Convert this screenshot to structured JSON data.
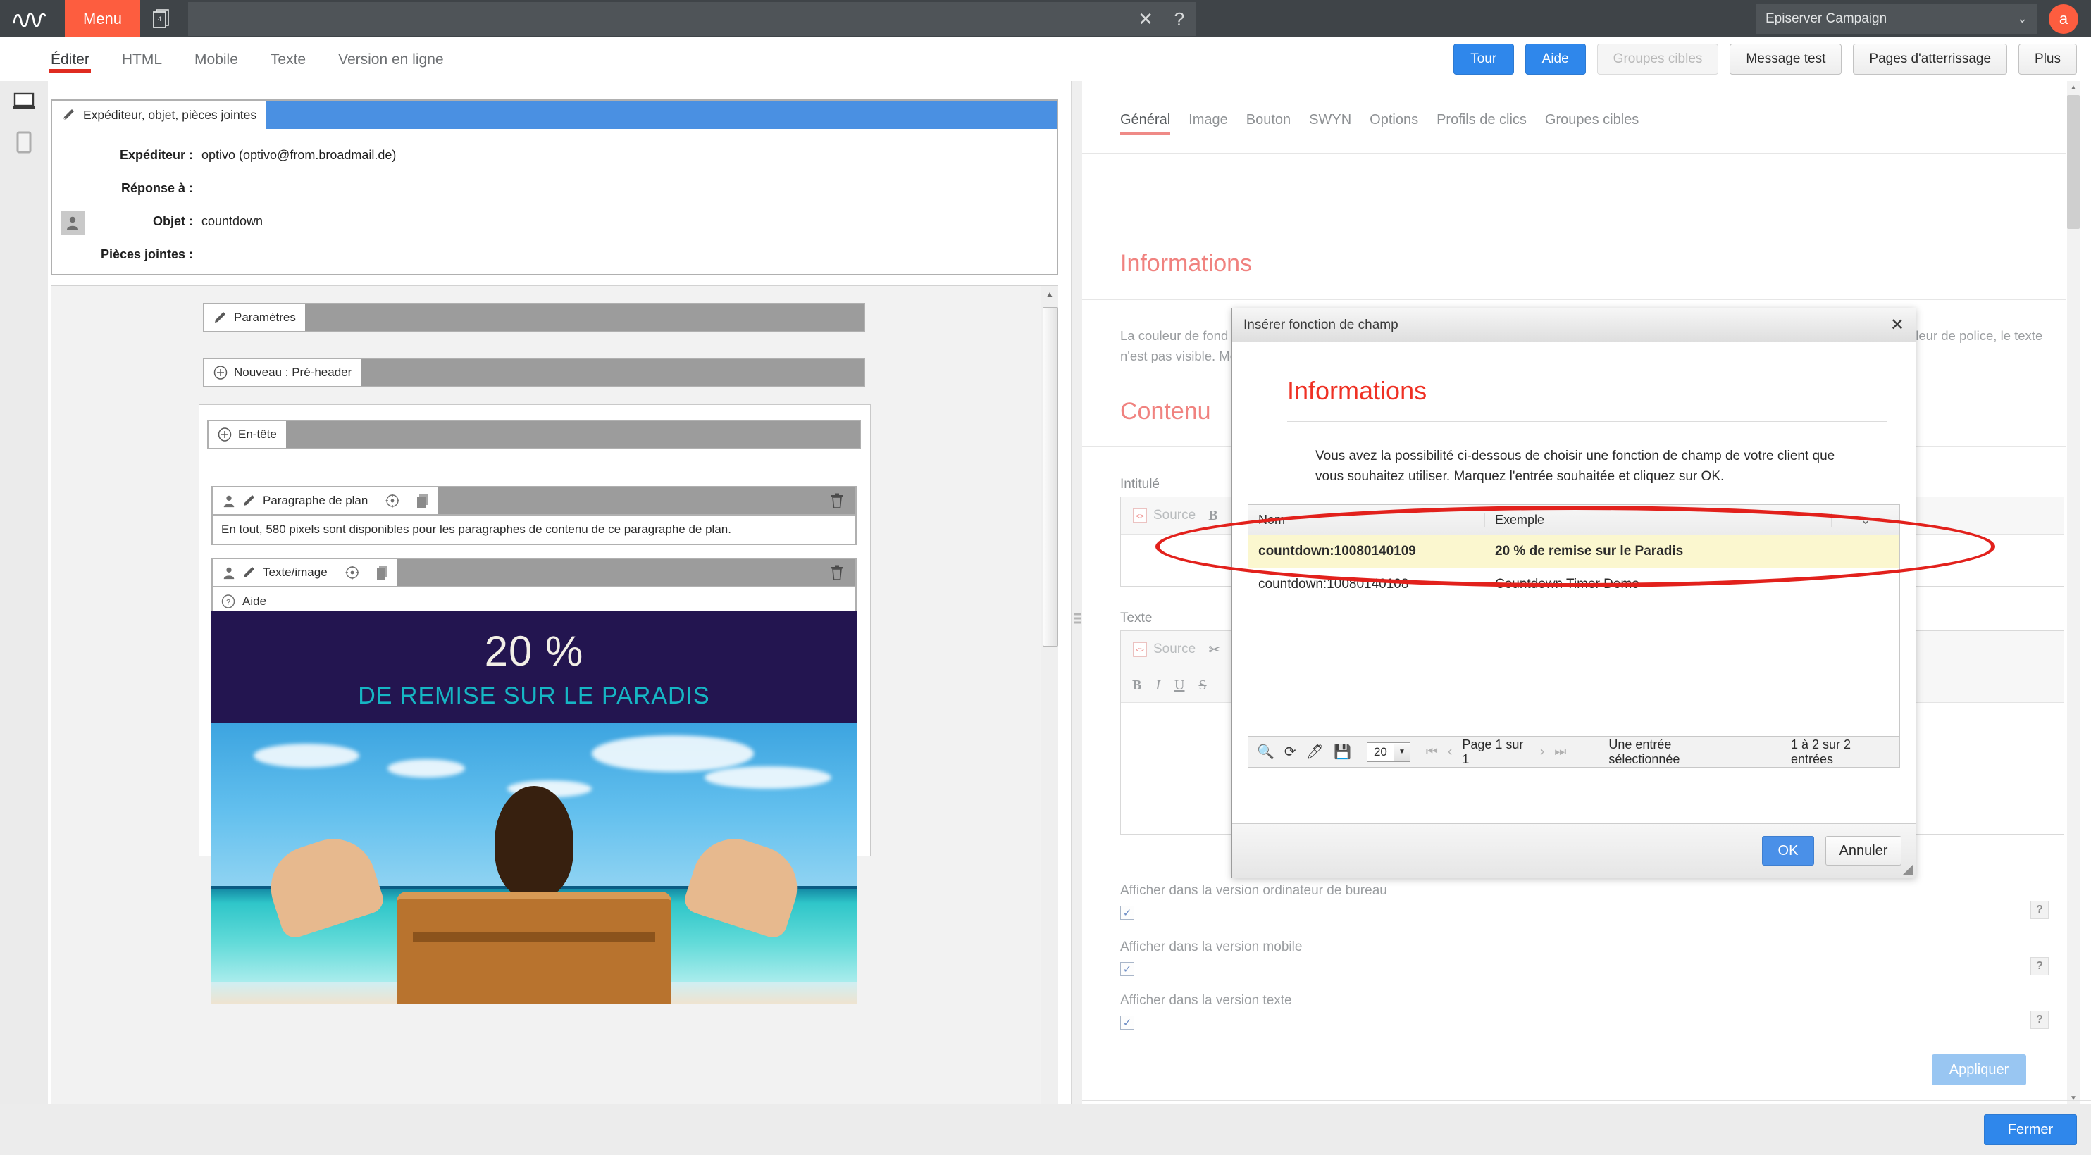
{
  "topbar": {
    "menu_label": "Menu",
    "stack_badge": "4",
    "search_value": "",
    "close_icon": "close-icon",
    "help_icon": "help-circle-icon",
    "client": "Episerver Campaign",
    "avatar_initial": "a"
  },
  "nav": {
    "tabs": [
      {
        "label": "Éditer",
        "active": true
      },
      {
        "label": "HTML",
        "active": false
      },
      {
        "label": "Mobile",
        "active": false
      },
      {
        "label": "Texte",
        "active": false
      },
      {
        "label": "Version en ligne",
        "active": false
      }
    ],
    "buttons": [
      {
        "label": "Tour",
        "style": "blue"
      },
      {
        "label": "Aide",
        "style": "blue"
      },
      {
        "label": "Groupes cibles",
        "style": "disabled"
      },
      {
        "label": "Message test",
        "style": "grey"
      },
      {
        "label": "Pages d'atterrissage",
        "style": "grey"
      },
      {
        "label": "Plus",
        "style": "grey"
      }
    ]
  },
  "rail": {
    "desktop_icon": "desktop-preview-icon",
    "mobile_icon": "mobile-preview-icon"
  },
  "sender": {
    "header": "Expéditeur, objet, pièces jointes",
    "rows": [
      {
        "label": "Expéditeur :",
        "value": "optivo (optivo@from.broadmail.de)"
      },
      {
        "label": "Réponse à :",
        "value": ""
      },
      {
        "label": "Objet :",
        "value": "countdown"
      },
      {
        "label": "Pièces jointes :",
        "value": ""
      }
    ]
  },
  "canvas": {
    "blocks": [
      {
        "label": "Paramètres",
        "icon": "brush-icon"
      },
      {
        "label": "Nouveau : Pré-header",
        "icon": "plus-circle-icon"
      },
      {
        "label": "En-tête",
        "icon": "plus-circle-icon"
      },
      {
        "label": "Paragraphe de plan",
        "icon": "brush-icon",
        "body": "En tout, 580 pixels sont disponibles pour les paragraphes de contenu de ce paragraphe de plan."
      },
      {
        "label": "Texte/image",
        "icon": "brush-icon",
        "body": "Aide"
      }
    ],
    "banner": {
      "percent": "20 %",
      "subtitle": "DE REMISE SUR LE PARADIS"
    }
  },
  "right": {
    "tabs": [
      {
        "label": "Général",
        "active": true
      },
      {
        "label": "Image",
        "active": false
      },
      {
        "label": "Bouton",
        "active": false
      },
      {
        "label": "SWYN",
        "active": false
      },
      {
        "label": "Options",
        "active": false
      },
      {
        "label": "Profils de clics",
        "active": false
      },
      {
        "label": "Groupes cibles",
        "active": false
      }
    ],
    "info_heading": "Informations",
    "info_text": "La couleur de fond du paragraphe est définie par les paramètres du modèle ou du paragraphe. Si la couleur de fond est identique à la couleur de police, le texte n'est pas visible. Modifiez dans ce cas la couleur de police à l'aide de l'éditeur de texte enrichi.",
    "content_heading": "Contenu",
    "field_intitule": "Intitulé",
    "field_texte": "Texte",
    "source_label": "Source",
    "bold_label": "B",
    "italic_label": "I",
    "underline_label": "U",
    "strike_label": "S",
    "checkboxes": [
      {
        "label": "Afficher dans la version ordinateur de bureau",
        "checked": true,
        "help": "?"
      },
      {
        "label": "Afficher dans la version mobile",
        "checked": true,
        "help": "?"
      },
      {
        "label": "Afficher dans la version texte",
        "checked": true,
        "help": "?"
      }
    ],
    "apply_label": "Appliquer"
  },
  "bottom": {
    "close_label": "Fermer"
  },
  "modal": {
    "title": "Insérer fonction de champ",
    "close_icon": "close-icon",
    "heading": "Informations",
    "description": "Vous avez la possibilité ci-dessous de choisir une fonction de champ de votre client que vous souhaitez utiliser. Marquez l'entrée souhaitée et cliquez sur OK.",
    "columns": [
      "Nom",
      "Exemple",
      ""
    ],
    "rows": [
      {
        "nom": "countdown:10080140109",
        "exemple": "20 % de remise sur le Paradis",
        "selected": true
      },
      {
        "nom": "countdown:10080140108",
        "exemple": "Countdown Timer Demo",
        "selected": false
      }
    ],
    "toolbar": {
      "search_icon": "search-icon",
      "refresh_icon": "refresh-icon",
      "clear_icon": "eraser-icon",
      "save_icon": "save-icon",
      "page_size": "20",
      "first_icon": "first-page-icon",
      "prev_icon": "prev-page-icon",
      "page_text": "Page 1 sur 1",
      "next_icon": "next-page-icon",
      "last_icon": "last-page-icon",
      "selection_text": "Une entrée sélectionnée",
      "range_text": "1 à 2 sur 2 entrées"
    },
    "ok_label": "OK",
    "cancel_label": "Annuler"
  },
  "colors": {
    "brand_orange": "#fd5d3f",
    "accent_blue": "#2f87eb",
    "accent_pink": "#f0827f",
    "modal_red": "#ef3124",
    "annotation_red": "#e2211c",
    "banner_bg": "#231550",
    "banner_teal": "#16b6c4",
    "selected_row": "#fbf7cf"
  }
}
